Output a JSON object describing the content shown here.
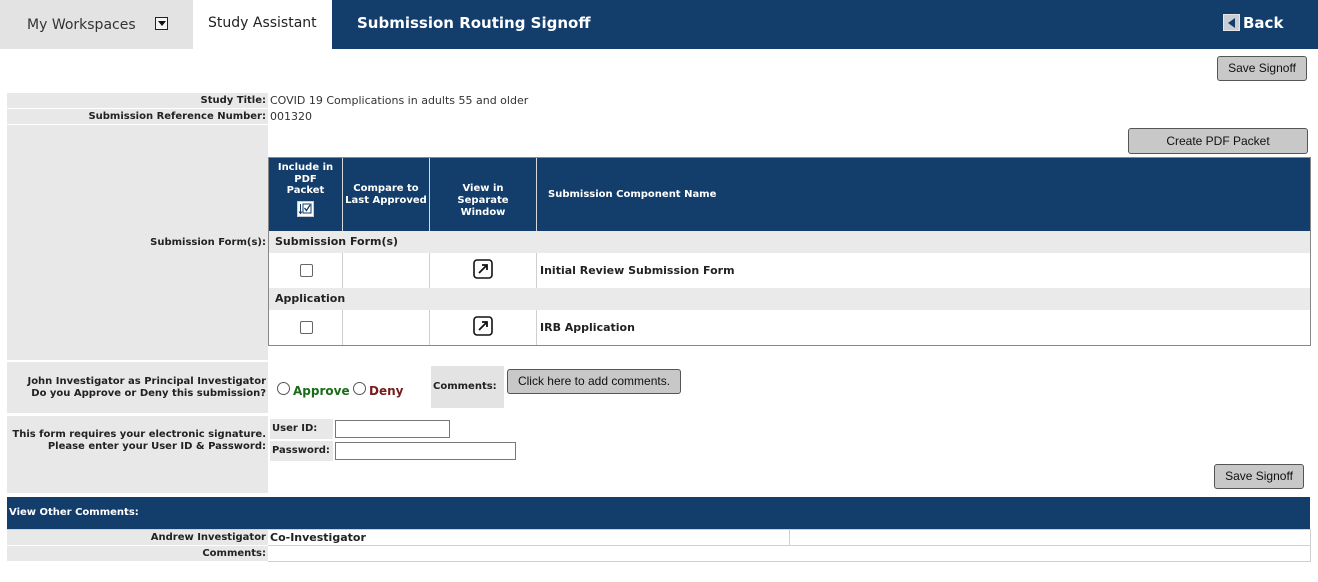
{
  "nav": {
    "workspaces_label": "My Workspaces",
    "study_assistant_label": "Study Assistant",
    "page_title": "Submission Routing Signoff",
    "back_label": "Back"
  },
  "buttons": {
    "save_signoff": "Save Signoff",
    "create_pdf": "Create PDF Packet",
    "add_comments": "Click here to add comments."
  },
  "study": {
    "title_label": "Study Title:",
    "title_value": "COVID 19 Complications in adults 55 and older",
    "ref_label": "Submission Reference Number:",
    "ref_value": "001320"
  },
  "components": {
    "row_label": "Submission Form(s):",
    "headers": {
      "include": "Include in PDF Packet",
      "compare": "Compare to Last Approved",
      "view": "View in Separate Window",
      "name": "Submission Component Name"
    },
    "sections": [
      {
        "title": "Submission Form(s)",
        "items": [
          {
            "name": "Initial Review Submission Form",
            "checked": false
          }
        ]
      },
      {
        "title": "Application",
        "items": [
          {
            "name": "IRB Application",
            "checked": false
          }
        ]
      }
    ]
  },
  "approval": {
    "question_line1": "John Investigator  as Principal Investigator",
    "question_line2": "Do you Approve or Deny this submission?",
    "approve_label": "Approve",
    "deny_label": "Deny",
    "comments_label": "Comments:",
    "approve_color": "#1a6b1a",
    "deny_color": "#7a1a1a"
  },
  "signature": {
    "line1": "This form requires your electronic signature.",
    "line2": "Please enter your User ID & Password:",
    "userid_label": "User ID:",
    "password_label": "Password:",
    "userid_value": "",
    "password_value": ""
  },
  "other_comments": {
    "header": "View Other Comments:",
    "entries": [
      {
        "name": "Andrew Investigator",
        "role": "Co-Investigator",
        "comments_label": "Comments:",
        "comments": ""
      }
    ]
  },
  "colors": {
    "brand_navy": "#133d6b",
    "label_gray": "#e8e8e8"
  }
}
